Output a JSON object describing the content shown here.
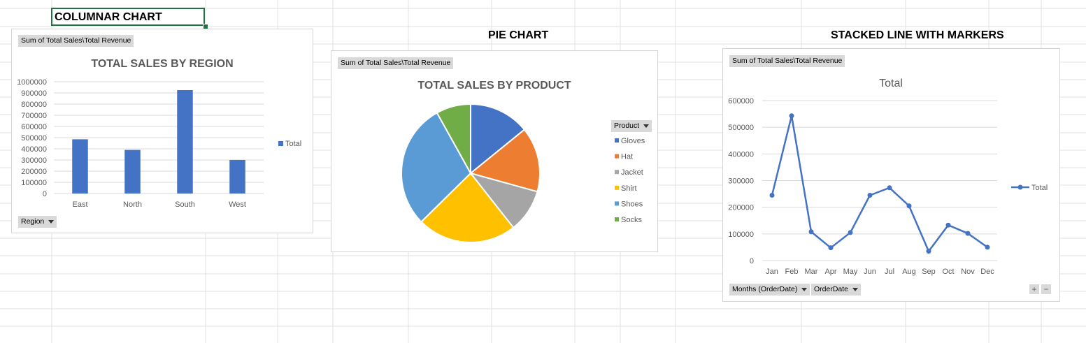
{
  "headings": {
    "columnar": "COLUMNAR CHART",
    "pie": "PIE CHART",
    "line": "STACKED LINE WITH MARKERS"
  },
  "chart_data": [
    {
      "type": "bar",
      "field_button": "Sum of Total Sales\\Total Revenue",
      "title": "TOTAL SALES BY REGION",
      "categories": [
        "East",
        "North",
        "South",
        "West"
      ],
      "series": [
        {
          "name": "Total",
          "values": [
            485000,
            390000,
            925000,
            300000
          ],
          "color": "#4472c4"
        }
      ],
      "ylim": [
        0,
        1000000
      ],
      "yticks": [
        0,
        100000,
        200000,
        300000,
        400000,
        500000,
        600000,
        700000,
        800000,
        900000,
        1000000
      ],
      "grid": true,
      "legend": "right",
      "axis_field_button": "Region"
    },
    {
      "type": "pie",
      "field_button": "Sum of Total Sales\\Total Revenue",
      "title": "TOTAL SALES BY PRODUCT",
      "legend_title": "Product",
      "labels": [
        "Gloves",
        "Hat",
        "Jacket",
        "Shirt",
        "Shoes",
        "Socks"
      ],
      "values": [
        140000,
        150000,
        100000,
        230000,
        290000,
        80000
      ],
      "colors": [
        "#4472c4",
        "#ed7d31",
        "#a5a5a5",
        "#ffc000",
        "#5b9bd5",
        "#70ad47"
      ],
      "legend": "right"
    },
    {
      "type": "line",
      "field_button": "Sum of Total Sales\\Total Revenue",
      "title": "Total",
      "categories": [
        "Jan",
        "Feb",
        "Mar",
        "Apr",
        "May",
        "Jun",
        "Jul",
        "Aug",
        "Sep",
        "Oct",
        "Nov",
        "Dec"
      ],
      "series": [
        {
          "name": "Total",
          "values": [
            245000,
            543000,
            108000,
            48000,
            105000,
            245000,
            273000,
            205000,
            35000,
            133000,
            102000,
            50000
          ],
          "color": "#4472c4"
        }
      ],
      "ylim": [
        0,
        600000
      ],
      "yticks": [
        0,
        100000,
        200000,
        300000,
        400000,
        500000,
        600000
      ],
      "grid": true,
      "legend": "right",
      "axis_field_buttons": [
        "Months (OrderDate)",
        "OrderDate"
      ],
      "zoom_buttons": [
        "+",
        "−"
      ]
    }
  ]
}
